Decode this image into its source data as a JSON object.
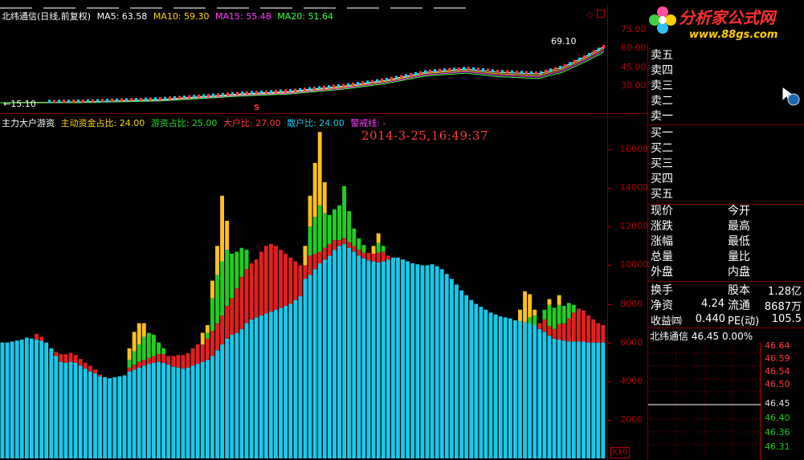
{
  "colors": {
    "retail": "#19c8ea",
    "big_holder": "#e02020",
    "hot_money": "#22cc22",
    "main_force": "#ffc020",
    "grid_red": "#b40000",
    "ma5": "#ffffff",
    "ma10": "#ffd800",
    "ma15": "#ff40ff",
    "ma20": "#40ff40"
  },
  "main_chart": {
    "title": "北纬通信(日线,前复权)",
    "ma": [
      {
        "label": "MA5: 63.58",
        "color": "#ffffff"
      },
      {
        "label": "MA10: 59.30",
        "color": "#ffd800"
      },
      {
        "label": "MA15: 55.48",
        "color": "#ff40ff"
      },
      {
        "label": "MA20: 51.64",
        "color": "#40ff40"
      }
    ],
    "high_label": "69.10",
    "low_label": "←15.10",
    "marker": "S",
    "y_ticks": [
      "75.00",
      "60.00",
      "45.00",
      "30.00"
    ]
  },
  "indicator": {
    "name": "主力大户游资",
    "params": [
      {
        "label": "主动资金占比: 24.00",
        "color": "#ffd800"
      },
      {
        "label": "游资占比: 25.00",
        "color": "#22dd22"
      },
      {
        "label": "大户比: 27.00",
        "color": "#ff3b3b"
      },
      {
        "label": "散户比: 24.00",
        "color": "#19c8ea"
      },
      {
        "label": "警戒线: -",
        "color": "#ff40ff"
      }
    ],
    "datetime": "2014-3-25,16:49:37",
    "y_ticks": [
      "16000",
      "14000",
      "12000",
      "10000",
      "8000",
      "6000",
      "4000",
      "2000"
    ],
    "multiplier": "X10"
  },
  "chart_data": {
    "type": "bar",
    "stacked": true,
    "ylim": [
      0,
      17000
    ],
    "series_names": [
      "散户",
      "大户",
      "游资",
      "主力"
    ],
    "values": [
      [
        6000,
        0,
        0,
        0
      ],
      [
        6000,
        0,
        0,
        0
      ],
      [
        6050,
        0,
        0,
        0
      ],
      [
        6100,
        0,
        0,
        0
      ],
      [
        6150,
        0,
        0,
        0
      ],
      [
        6250,
        0,
        0,
        0
      ],
      [
        6200,
        0,
        0,
        0
      ],
      [
        6150,
        300,
        0,
        0
      ],
      [
        6100,
        200,
        0,
        0
      ],
      [
        6000,
        0,
        0,
        0
      ],
      [
        5700,
        0,
        0,
        0
      ],
      [
        5300,
        200,
        0,
        0
      ],
      [
        5000,
        400,
        0,
        0
      ],
      [
        4950,
        450,
        0,
        0
      ],
      [
        5000,
        450,
        0,
        0
      ],
      [
        4950,
        400,
        0,
        0
      ],
      [
        4800,
        350,
        0,
        0
      ],
      [
        4650,
        300,
        0,
        0
      ],
      [
        4500,
        300,
        0,
        0
      ],
      [
        4400,
        200,
        0,
        0
      ],
      [
        4250,
        100,
        0,
        0
      ],
      [
        4200,
        0,
        0,
        0
      ],
      [
        4150,
        0,
        0,
        0
      ],
      [
        4200,
        0,
        0,
        0
      ],
      [
        4250,
        0,
        0,
        0
      ],
      [
        4300,
        0,
        0,
        0
      ],
      [
        4500,
        200,
        400,
        600
      ],
      [
        4600,
        250,
        700,
        1000
      ],
      [
        4700,
        300,
        900,
        1100
      ],
      [
        4800,
        300,
        1200,
        700
      ],
      [
        4900,
        300,
        1300,
        0
      ],
      [
        4950,
        350,
        1100,
        0
      ],
      [
        5000,
        400,
        600,
        0
      ],
      [
        4950,
        450,
        300,
        0
      ],
      [
        4850,
        450,
        0,
        0
      ],
      [
        4750,
        550,
        0,
        0
      ],
      [
        4700,
        650,
        0,
        0
      ],
      [
        4650,
        700,
        0,
        0
      ],
      [
        4700,
        750,
        0,
        0
      ],
      [
        4800,
        900,
        0,
        0
      ],
      [
        4900,
        1000,
        0,
        0
      ],
      [
        5000,
        900,
        0,
        600
      ],
      [
        5100,
        1100,
        300,
        400
      ],
      [
        5300,
        1300,
        1700,
        900
      ],
      [
        5600,
        1400,
        2500,
        1500
      ],
      [
        5900,
        1500,
        2800,
        3400
      ],
      [
        6200,
        1700,
        2900,
        1500
      ],
      [
        6400,
        1900,
        2300,
        0
      ],
      [
        6500,
        2300,
        1900,
        0
      ],
      [
        6700,
        2700,
        1500,
        0
      ],
      [
        7000,
        2800,
        1000,
        0
      ],
      [
        7200,
        2900,
        0,
        0
      ],
      [
        7300,
        3000,
        0,
        0
      ],
      [
        7400,
        3300,
        0,
        0
      ],
      [
        7500,
        3500,
        0,
        0
      ],
      [
        7600,
        3500,
        0,
        0
      ],
      [
        7700,
        3300,
        0,
        0
      ],
      [
        7800,
        3000,
        0,
        0
      ],
      [
        7900,
        2700,
        0,
        0
      ],
      [
        8000,
        2400,
        0,
        0
      ],
      [
        8200,
        2000,
        0,
        0
      ],
      [
        8400,
        1600,
        0,
        0
      ],
      [
        9300,
        700,
        0,
        1000
      ],
      [
        9500,
        1000,
        1500,
        1600
      ],
      [
        9800,
        800,
        1900,
        2800
      ],
      [
        10100,
        600,
        2400,
        3800
      ],
      [
        10300,
        600,
        1800,
        1600
      ],
      [
        10500,
        600,
        1500,
        0
      ],
      [
        10800,
        500,
        1600,
        0
      ],
      [
        11000,
        300,
        1800,
        0
      ],
      [
        11100,
        300,
        2700,
        0
      ],
      [
        10900,
        300,
        1600,
        0
      ],
      [
        10700,
        300,
        900,
        0
      ],
      [
        10500,
        300,
        600,
        0
      ],
      [
        10350,
        300,
        400,
        0
      ],
      [
        10250,
        400,
        0,
        0
      ],
      [
        10200,
        400,
        0,
        400
      ],
      [
        10150,
        500,
        500,
        500
      ],
      [
        10200,
        500,
        300,
        0
      ],
      [
        10300,
        200,
        0,
        0
      ],
      [
        10400,
        0,
        0,
        0
      ],
      [
        10400,
        0,
        0,
        0
      ],
      [
        10300,
        0,
        0,
        0
      ],
      [
        10200,
        0,
        0,
        0
      ],
      [
        10100,
        0,
        0,
        0
      ],
      [
        10050,
        0,
        0,
        0
      ],
      [
        10000,
        0,
        0,
        0
      ],
      [
        10000,
        0,
        0,
        0
      ],
      [
        10050,
        0,
        0,
        0
      ],
      [
        9950,
        0,
        0,
        0
      ],
      [
        9800,
        0,
        0,
        0
      ],
      [
        9550,
        0,
        0,
        0
      ],
      [
        9300,
        0,
        0,
        0
      ],
      [
        9000,
        0,
        0,
        0
      ],
      [
        8700,
        0,
        0,
        0
      ],
      [
        8450,
        0,
        0,
        0
      ],
      [
        8200,
        0,
        0,
        0
      ],
      [
        8000,
        0,
        0,
        0
      ],
      [
        7850,
        0,
        0,
        0
      ],
      [
        7700,
        0,
        0,
        0
      ],
      [
        7550,
        0,
        0,
        0
      ],
      [
        7450,
        0,
        0,
        0
      ],
      [
        7350,
        0,
        0,
        0
      ],
      [
        7300,
        0,
        0,
        0
      ],
      [
        7250,
        0,
        0,
        0
      ],
      [
        7150,
        0,
        0,
        0
      ],
      [
        7100,
        0,
        0,
        600
      ],
      [
        7050,
        0,
        0,
        1600
      ],
      [
        7000,
        0,
        300,
        1200
      ],
      [
        6900,
        0,
        500,
        300
      ],
      [
        6700,
        300,
        0,
        0
      ],
      [
        6550,
        650,
        500,
        0
      ],
      [
        6350,
        500,
        1100,
        300
      ],
      [
        6200,
        500,
        1100,
        0
      ],
      [
        6150,
        800,
        1000,
        500
      ],
      [
        6100,
        900,
        900,
        0
      ],
      [
        6050,
        1200,
        800,
        0
      ],
      [
        6050,
        1500,
        400,
        0
      ],
      [
        6050,
        1700,
        0,
        0
      ],
      [
        6050,
        1600,
        0,
        0
      ],
      [
        6000,
        1400,
        0,
        0
      ],
      [
        6000,
        1200,
        0,
        0
      ],
      [
        6000,
        1000,
        0,
        0
      ],
      [
        6000,
        900,
        0,
        0
      ]
    ]
  },
  "order_book": {
    "sell": [
      "卖五",
      "卖四",
      "卖三",
      "卖二",
      "卖一"
    ],
    "buy": [
      "买一",
      "买二",
      "买三",
      "买四",
      "买五"
    ]
  },
  "quote": {
    "left_labels": [
      "现价",
      "涨跌",
      "涨幅",
      "总量",
      "外盘"
    ],
    "right_labels": [
      "今开",
      "最高",
      "最低",
      "量比",
      "内盘"
    ],
    "turnover_label": "换手",
    "capital_label": "股本",
    "capital_value": "1.28亿",
    "net_asset_label": "净资",
    "net_asset_value": "4.24",
    "float_label": "流通",
    "float_value": "8687万",
    "eps_label": "收益㈣",
    "eps_value": "0.440",
    "pe_label": "PE(动)",
    "pe_value": "105.5"
  },
  "minute_chart": {
    "stock_line": "北纬通信  46.45  0.00%",
    "red_prices": [
      "46.64",
      "46.59",
      "46.54",
      "46.50"
    ],
    "mid_price": "46.45",
    "green_prices": [
      "46.40",
      "46.36",
      "46.31"
    ]
  },
  "watermark": {
    "brand": "分析家公式网",
    "url": "www.88gs.com"
  }
}
